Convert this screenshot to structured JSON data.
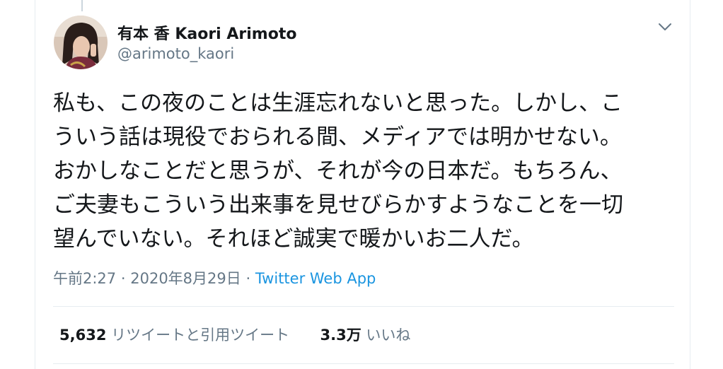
{
  "user": {
    "display_name": "有本 香 Kaori Arimoto",
    "handle": "@arimoto_kaori",
    "avatar_icon": "user-avatar-photo"
  },
  "tweet": {
    "lines": [
      "私も、この夜のことは生涯忘れないと思った。しかし、こ",
      "ういう話は現役でおられる間、メディアでは明かせない。",
      "おかしなことだと思うが、それが今の日本だ。もちろん、",
      "ご夫妻もこういう出来事を見せびらかすようなことを一切",
      "望んでいない。それほど誠実で暖かいお二人だ。"
    ]
  },
  "meta": {
    "time": "午前2:27",
    "separator": "·",
    "date": "2020年8月29日",
    "app": "Twitter Web App"
  },
  "stats": {
    "retweets_count": "5,632",
    "retweets_label": "リツイートと引用ツイート",
    "likes_count": "3.3万",
    "likes_label": "いいね"
  },
  "colors": {
    "text": "#14171a",
    "secondary": "#657786",
    "link": "#1b95e0",
    "border": "#e6ecf0"
  }
}
